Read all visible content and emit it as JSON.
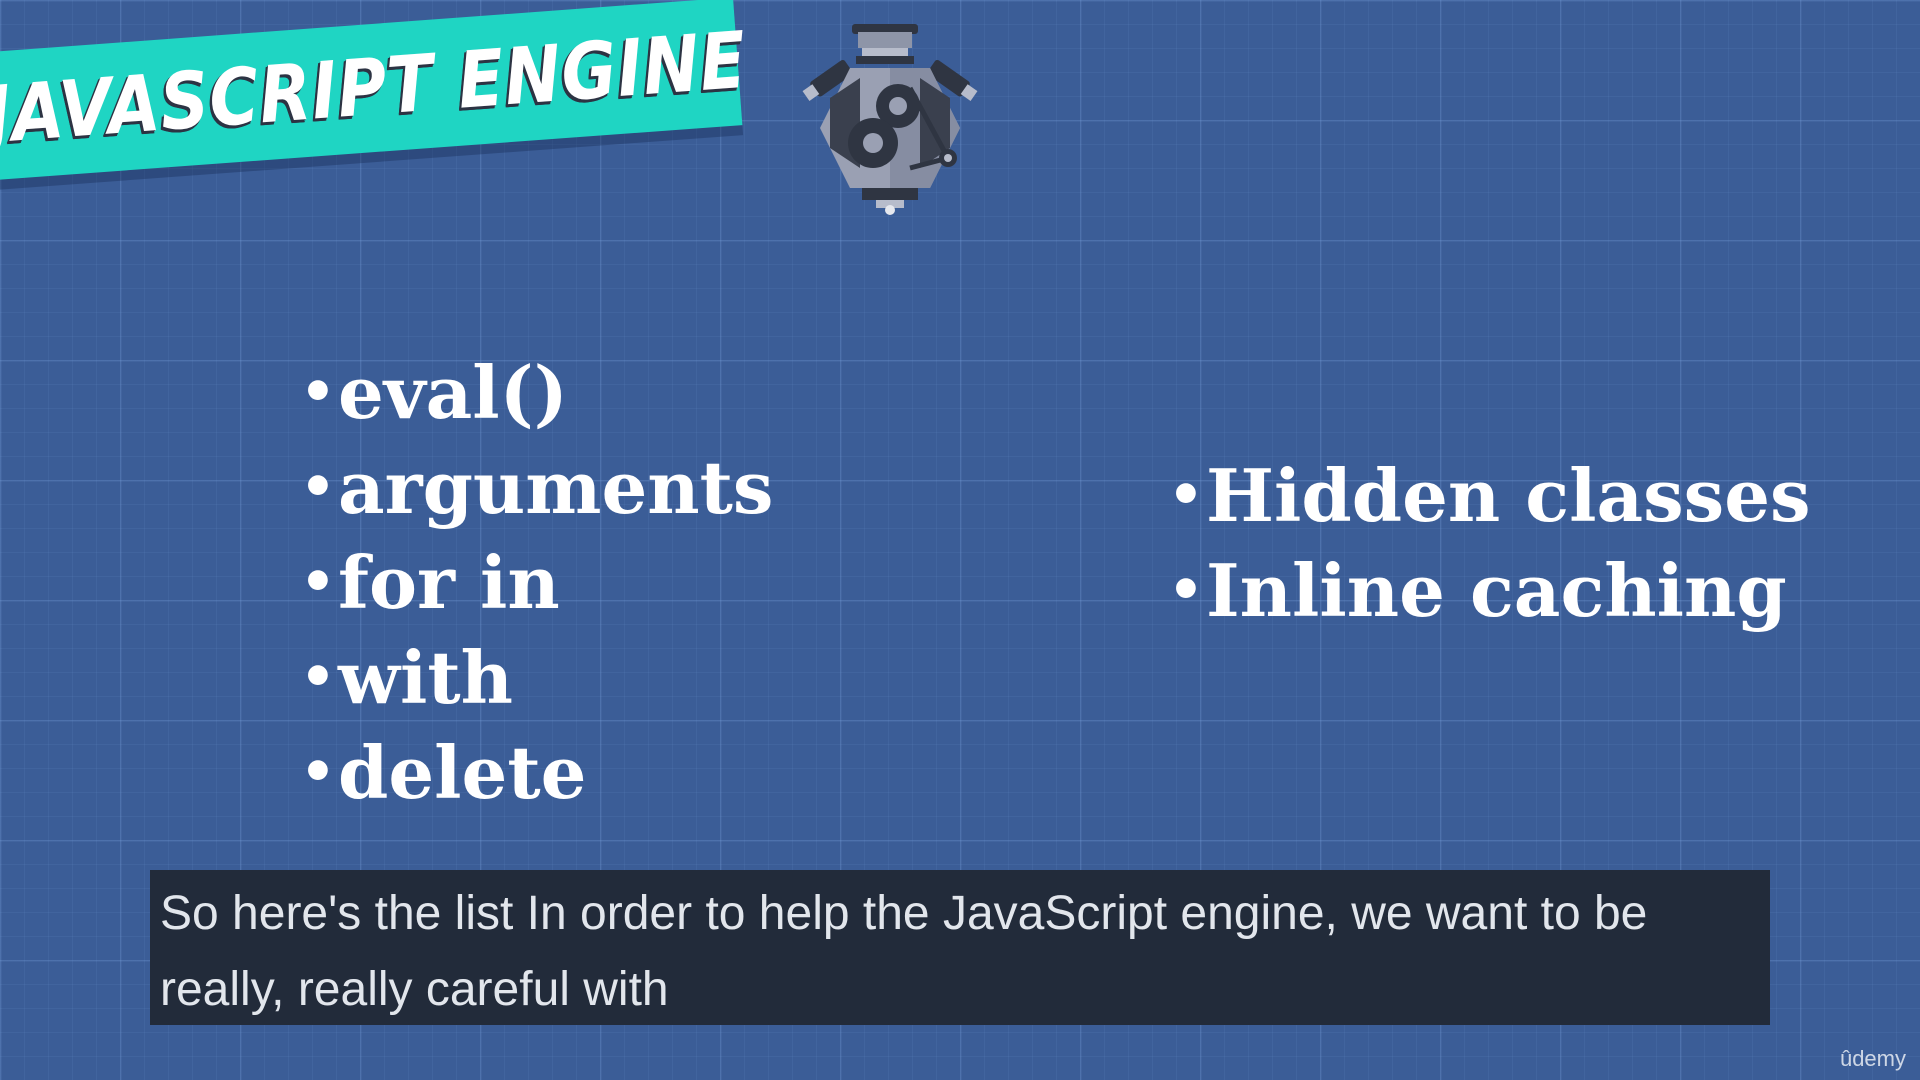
{
  "slide": {
    "title": "JAVASCRIPT ENGINE",
    "left_list": [
      {
        "bullet": "•",
        "text": "eval()"
      },
      {
        "bullet": "•",
        "text": "arguments"
      },
      {
        "bullet": "•",
        "text": "for in"
      },
      {
        "bullet": "•",
        "text": "with"
      },
      {
        "bullet": "•",
        "text": "delete"
      }
    ],
    "right_list": [
      {
        "bullet": "•",
        "text": "Hidden classes"
      },
      {
        "bullet": "•",
        "text": "Inline caching"
      }
    ],
    "illustration_icon": "engine-icon"
  },
  "caption": {
    "text": "So here's the list In order to help the JavaScript engine, we want to be really, really careful with"
  },
  "watermark": {
    "text": "ûdemy"
  },
  "colors": {
    "background": "#3b5d97",
    "banner": "#1fd5c3",
    "caption_bg": "#222b3a",
    "text": "#ffffff"
  }
}
